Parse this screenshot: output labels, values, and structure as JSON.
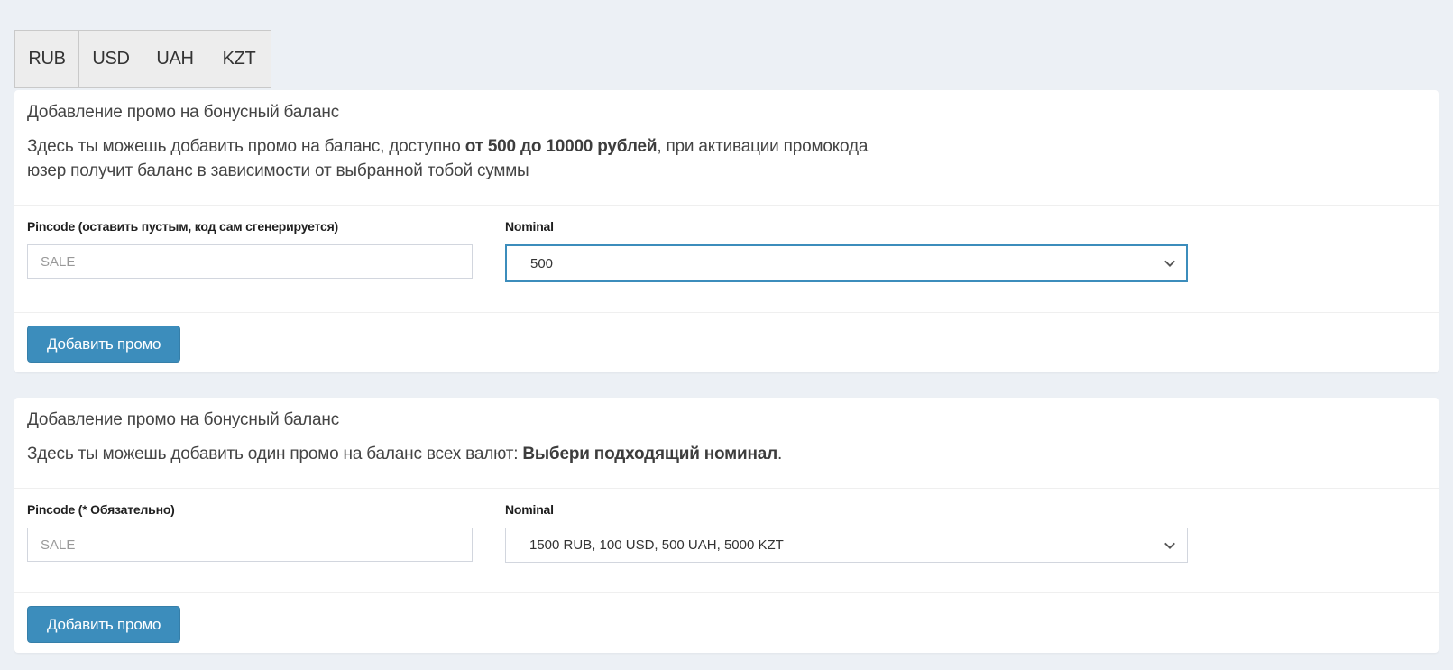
{
  "page": {
    "background": "#ecf0f5",
    "accent_color": "#3c8dbc",
    "panel_background": "#ffffff"
  },
  "currency_tabs": [
    {
      "label": "RUB"
    },
    {
      "label": "USD"
    },
    {
      "label": "UAH"
    },
    {
      "label": "KZT"
    }
  ],
  "panels": [
    {
      "title": "Добавление промо на бонусный баланс",
      "description": {
        "text_before": "Здесь ты можешь добавить промо на баланс, доступно ",
        "text_bold": "от 500 до 10000 рублей",
        "text_after_line1": ", при активации промокода",
        "text_after_line2": "юзер получит баланс в зависимости от выбранной тобой суммы"
      },
      "pincode": {
        "label": "Pincode (оставить пустым, код сам сгенерируется)",
        "placeholder": "SALE",
        "value": ""
      },
      "nominal": {
        "label": "Nominal",
        "selected": "500"
      },
      "submit_label": "Добавить промо"
    },
    {
      "title": "Добавление промо на бонусный баланс",
      "description": {
        "text_before": "Здесь ты можешь добавить один промо на баланс всех валют: ",
        "text_bold": "Выбери подходящий номинал",
        "text_after_line1": "."
      },
      "pincode": {
        "label": "Pincode (* Обязательно)",
        "placeholder": "SALE",
        "value": ""
      },
      "nominal": {
        "label": "Nominal",
        "selected": "1500 RUB, 100 USD, 500 UAH, 5000 KZT"
      },
      "submit_label": "Добавить промо"
    }
  ],
  "icons": {
    "select_chevron": "chevron-down"
  }
}
